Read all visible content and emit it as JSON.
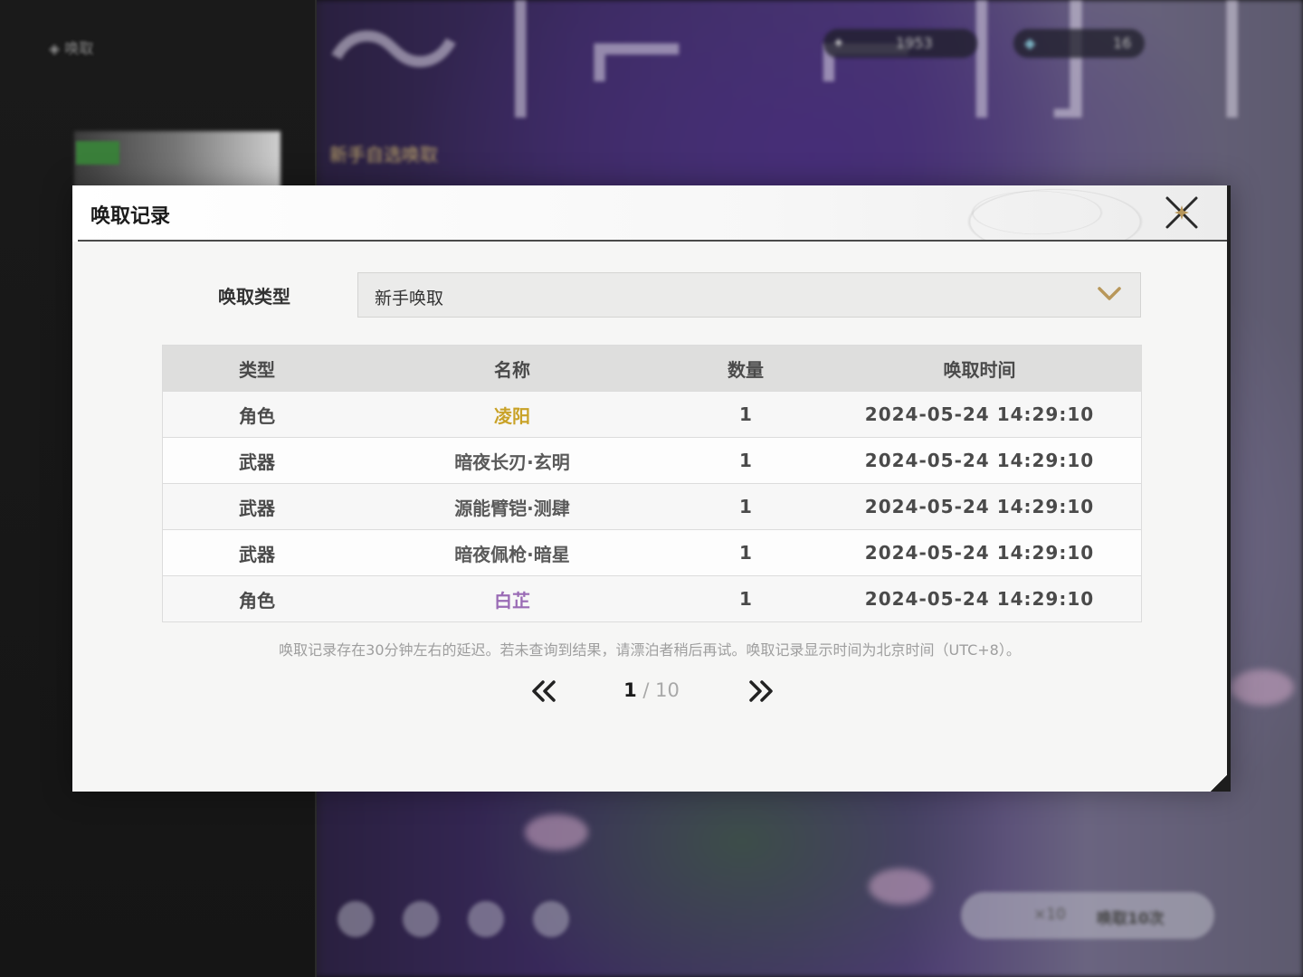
{
  "background": {
    "back_label": "唤取",
    "banner_subtitle": "新手自选唤取",
    "currency": [
      {
        "icon": "star-icon",
        "amount": "1953"
      },
      {
        "icon": "crystal-icon",
        "amount": "16"
      }
    ],
    "pull_button_label": "唤取10次",
    "pull_cost": "×10"
  },
  "modal": {
    "title": "唤取记录",
    "close_icon": "close-icon",
    "type_label": "唤取类型",
    "type_selected": "新手唤取",
    "table": {
      "headers": [
        "类型",
        "名称",
        "数量",
        "唤取时间"
      ],
      "rows": [
        {
          "type": "角色",
          "name": "凌阳",
          "qty": "1",
          "time": "2024-05-24 14:29:10",
          "rarity_color": "#c9a227"
        },
        {
          "type": "武器",
          "name": "暗夜长刃·玄明",
          "qty": "1",
          "time": "2024-05-24 14:29:10",
          "rarity_color": "#5a5a5a"
        },
        {
          "type": "武器",
          "name": "源能臂铠·测肆",
          "qty": "1",
          "time": "2024-05-24 14:29:10",
          "rarity_color": "#5a5a5a"
        },
        {
          "type": "武器",
          "name": "暗夜佩枪·暗星",
          "qty": "1",
          "time": "2024-05-24 14:29:10",
          "rarity_color": "#5a5a5a"
        },
        {
          "type": "角色",
          "name": "白芷",
          "qty": "1",
          "time": "2024-05-24 14:29:10",
          "rarity_color": "#9a6bb5"
        }
      ]
    },
    "notice": "唤取记录存在30分钟左右的延迟。若未查询到结果，请漂泊者稍后再试。唤取记录显示时间为北京时间（UTC+8）。",
    "pagination": {
      "current": "1",
      "separator": "/",
      "total": "10"
    }
  },
  "colors": {
    "accent_gold": "#b8975a",
    "legendary": "#c9a227",
    "epic": "#9a6bb5"
  }
}
